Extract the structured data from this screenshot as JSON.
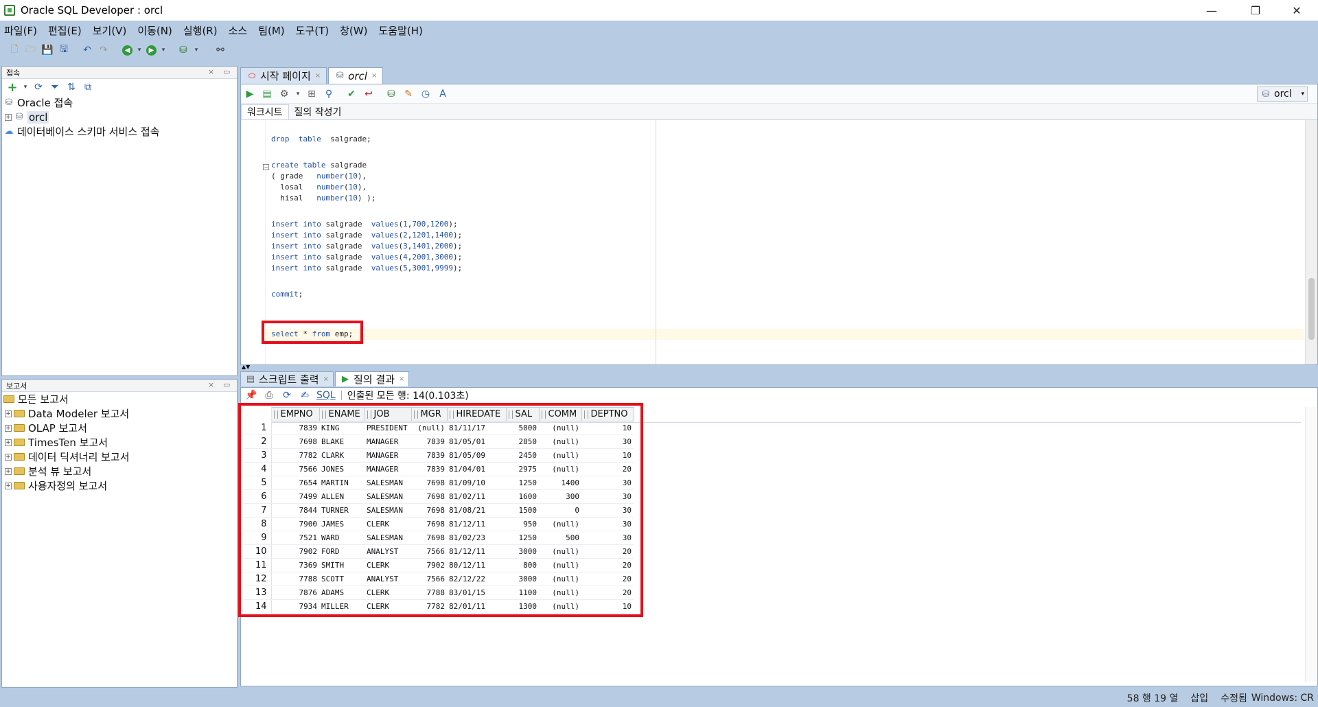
{
  "window": {
    "title": "Oracle SQL Developer : orcl",
    "minimize": "—",
    "restore": "❐",
    "close": "✕"
  },
  "menu": [
    "파일(F)",
    "편집(E)",
    "보기(V)",
    "이동(N)",
    "실행(R)",
    "소스",
    "팀(M)",
    "도구(T)",
    "창(W)",
    "도움말(H)"
  ],
  "connections_panel": {
    "title": "접속",
    "tree": [
      {
        "label": "Oracle 접속",
        "icon": "database-icon"
      },
      {
        "label": "orcl",
        "icon": "connection-icon"
      },
      {
        "label": "데이터베이스 스키마 서비스 접속",
        "icon": "cloud-icon"
      }
    ]
  },
  "reports_panel": {
    "title": "보고서",
    "tree": [
      {
        "label": "모든 보고서"
      },
      {
        "label": "Data Modeler 보고서"
      },
      {
        "label": "OLAP 보고서"
      },
      {
        "label": "TimesTen 보고서"
      },
      {
        "label": "데이터 딕셔너리 보고서"
      },
      {
        "label": "분석 뷰 보고서"
      },
      {
        "label": "사용자정의 보고서"
      }
    ]
  },
  "doc_tabs": [
    {
      "label": "시작 페이지",
      "active": false
    },
    {
      "label": "orcl",
      "active": true
    }
  ],
  "editor": {
    "connection": "orcl",
    "subtabs": [
      "워크시트",
      "질의 작성기"
    ],
    "lines": [
      "drop  table  salgrade;",
      "",
      "create table salgrade",
      "( grade   number(10),",
      "  losal   number(10),",
      "  hisal   number(10) );",
      "",
      "insert into salgrade  values(1,700,1200);",
      "insert into salgrade  values(2,1201,1400);",
      "insert into salgrade  values(3,1401,2000);",
      "insert into salgrade  values(4,2001,3000);",
      "insert into salgrade  values(5,3001,9999);",
      "",
      "commit;",
      "",
      "select * from emp;"
    ]
  },
  "results": {
    "tabs": [
      {
        "label": "스크립트 출력",
        "active": false
      },
      {
        "label": "질의 결과",
        "active": true
      }
    ],
    "sql_link": "SQL",
    "fetch_status": "인출된 모든 행: 14(0.103초)",
    "columns": [
      "EMPNO",
      "ENAME",
      "JOB",
      "MGR",
      "HIREDATE",
      "SAL",
      "COMM",
      "DEPTNO"
    ],
    "rows": [
      [
        "1",
        "7839",
        "KING",
        "PRESIDENT",
        "(null)",
        "81/11/17",
        "5000",
        "(null)",
        "10"
      ],
      [
        "2",
        "7698",
        "BLAKE",
        "MANAGER",
        "7839",
        "81/05/01",
        "2850",
        "(null)",
        "30"
      ],
      [
        "3",
        "7782",
        "CLARK",
        "MANAGER",
        "7839",
        "81/05/09",
        "2450",
        "(null)",
        "10"
      ],
      [
        "4",
        "7566",
        "JONES",
        "MANAGER",
        "7839",
        "81/04/01",
        "2975",
        "(null)",
        "20"
      ],
      [
        "5",
        "7654",
        "MARTIN",
        "SALESMAN",
        "7698",
        "81/09/10",
        "1250",
        "1400",
        "30"
      ],
      [
        "6",
        "7499",
        "ALLEN",
        "SALESMAN",
        "7698",
        "81/02/11",
        "1600",
        "300",
        "30"
      ],
      [
        "7",
        "7844",
        "TURNER",
        "SALESMAN",
        "7698",
        "81/08/21",
        "1500",
        "0",
        "30"
      ],
      [
        "8",
        "7900",
        "JAMES",
        "CLERK",
        "7698",
        "81/12/11",
        "950",
        "(null)",
        "30"
      ],
      [
        "9",
        "7521",
        "WARD",
        "SALESMAN",
        "7698",
        "81/02/23",
        "1250",
        "500",
        "30"
      ],
      [
        "10",
        "7902",
        "FORD",
        "ANALYST",
        "7566",
        "81/12/11",
        "3000",
        "(null)",
        "20"
      ],
      [
        "11",
        "7369",
        "SMITH",
        "CLERK",
        "7902",
        "80/12/11",
        "800",
        "(null)",
        "20"
      ],
      [
        "12",
        "7788",
        "SCOTT",
        "ANALYST",
        "7566",
        "82/12/22",
        "3000",
        "(null)",
        "20"
      ],
      [
        "13",
        "7876",
        "ADAMS",
        "CLERK",
        "7788",
        "83/01/15",
        "1100",
        "(null)",
        "20"
      ],
      [
        "14",
        "7934",
        "MILLER",
        "CLERK",
        "7782",
        "82/01/11",
        "1300",
        "(null)",
        "10"
      ]
    ]
  },
  "status": {
    "position": "58 행 19 열",
    "mode": "삽입",
    "modified": "수정됨",
    "line_endings": "Windows: CR"
  },
  "colors": {
    "highlight": "#e3111b",
    "background": "#b7cbe2"
  }
}
